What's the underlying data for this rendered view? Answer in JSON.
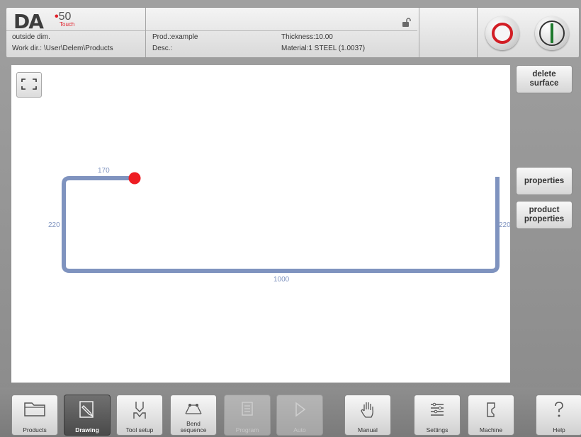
{
  "header": {
    "logo": {
      "brand": "DA",
      "model": "50",
      "edition": "Touch"
    },
    "mode": "outside dim.",
    "work_dir": "Work dir.: \\User\\Delem\\Products",
    "product": "Prod.:example",
    "description": "Desc.:",
    "thickness": "Thickness:10.00",
    "material": "Material:1 STEEL (1.0037)",
    "message": ""
  },
  "canvas": {
    "dimensions": {
      "top_flange": "170",
      "left_side": "220",
      "right_side": "220",
      "bottom": "1000"
    }
  },
  "side_buttons": {
    "delete_surface": "delete\nsurface",
    "properties": "properties",
    "product_properties": "product\nproperties"
  },
  "nav": [
    {
      "label": "Products",
      "icon": "folder-icon",
      "state": "normal"
    },
    {
      "label": "Drawing",
      "icon": "drawing-icon",
      "state": "active"
    },
    {
      "label": "Tool setup",
      "icon": "tool-setup-icon",
      "state": "normal"
    },
    {
      "label": "Bend\nsequence",
      "icon": "bend-sequence-icon",
      "state": "normal"
    },
    {
      "label": "Program",
      "icon": "program-icon",
      "state": "disabled"
    },
    {
      "label": "Auto",
      "icon": "play-icon",
      "state": "disabled"
    },
    {
      "label": "Manual",
      "icon": "hand-icon",
      "state": "normal"
    },
    {
      "label": "Settings",
      "icon": "settings-icon",
      "state": "normal"
    },
    {
      "label": "Machine",
      "icon": "machine-icon",
      "state": "normal"
    },
    {
      "label": "Help",
      "icon": "help-icon",
      "state": "normal"
    }
  ],
  "colors": {
    "profile": "#7f93bf",
    "endpoint": "#ee1d23",
    "stop": "#d21d24",
    "start": "#1f7a2e"
  }
}
